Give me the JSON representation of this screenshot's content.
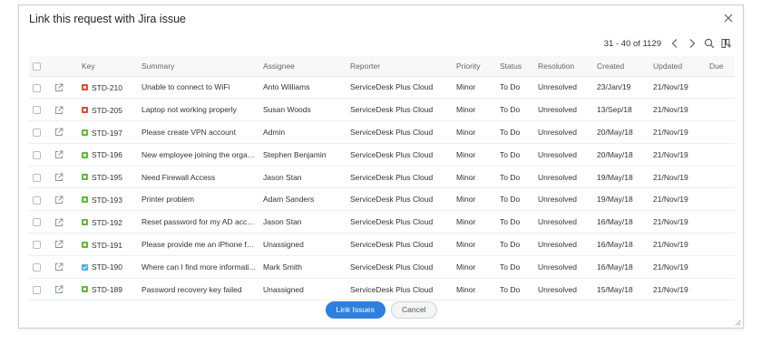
{
  "dialog": {
    "title": "Link this request with Jira issue",
    "pagination": "31 - 40 of 1129"
  },
  "table": {
    "headers": {
      "key": "Key",
      "summary": "Summary",
      "assignee": "Assignee",
      "reporter": "Reporter",
      "priority": "Priority",
      "status": "Status",
      "resolution": "Resolution",
      "created": "Created",
      "updated": "Updated",
      "due": "Due"
    },
    "rows": [
      {
        "type": "bug",
        "key": "STD-210",
        "summary": "Unable to connect to WiFi",
        "assignee": "Anto Williams",
        "reporter": "ServiceDesk Plus Cloud",
        "priority": "Minor",
        "status": "To Do",
        "resolution": "Unresolved",
        "created": "23/Jan/19",
        "updated": "21/Nov/19",
        "due": ""
      },
      {
        "type": "bug",
        "key": "STD-205",
        "summary": "Laptop not working properly",
        "assignee": "Susan Woods",
        "reporter": "ServiceDesk Plus Cloud",
        "priority": "Minor",
        "status": "To Do",
        "resolution": "Unresolved",
        "created": "13/Sep/18",
        "updated": "21/Nov/19",
        "due": ""
      },
      {
        "type": "story",
        "key": "STD-197",
        "summary": "Please create VPN account",
        "assignee": "Admin",
        "reporter": "ServiceDesk Plus Cloud",
        "priority": "Minor",
        "status": "To Do",
        "resolution": "Unresolved",
        "created": "20/May/18",
        "updated": "21/Nov/19",
        "due": ""
      },
      {
        "type": "story",
        "key": "STD-196",
        "summary": "New employee joining the organ...",
        "assignee": "Stephen Benjamin",
        "reporter": "ServiceDesk Plus Cloud",
        "priority": "Minor",
        "status": "To Do",
        "resolution": "Unresolved",
        "created": "20/May/18",
        "updated": "21/Nov/19",
        "due": ""
      },
      {
        "type": "story",
        "key": "STD-195",
        "summary": "Need Firewall Access",
        "assignee": "Jason Stan",
        "reporter": "ServiceDesk Plus Cloud",
        "priority": "Minor",
        "status": "To Do",
        "resolution": "Unresolved",
        "created": "19/May/18",
        "updated": "21/Nov/19",
        "due": ""
      },
      {
        "type": "story",
        "key": "STD-193",
        "summary": "Printer problem",
        "assignee": "Adam Sanders",
        "reporter": "ServiceDesk Plus Cloud",
        "priority": "Minor",
        "status": "To Do",
        "resolution": "Unresolved",
        "created": "19/May/18",
        "updated": "21/Nov/19",
        "due": ""
      },
      {
        "type": "story",
        "key": "STD-192",
        "summary": "Reset password for my AD acco...",
        "assignee": "Jason Stan",
        "reporter": "ServiceDesk Plus Cloud",
        "priority": "Minor",
        "status": "To Do",
        "resolution": "Unresolved",
        "created": "16/May/18",
        "updated": "21/Nov/19",
        "due": ""
      },
      {
        "type": "story",
        "key": "STD-191",
        "summary": "Please provide me an iPhone for...",
        "assignee": "Unassigned",
        "reporter": "ServiceDesk Plus Cloud",
        "priority": "Minor",
        "status": "To Do",
        "resolution": "Unresolved",
        "created": "16/May/18",
        "updated": "21/Nov/19",
        "due": ""
      },
      {
        "type": "task",
        "key": "STD-190",
        "summary": "Where can I find more informati...",
        "assignee": "Mark Smith",
        "reporter": "ServiceDesk Plus Cloud",
        "priority": "Minor",
        "status": "To Do",
        "resolution": "Unresolved",
        "created": "16/May/18",
        "updated": "21/Nov/19",
        "due": ""
      },
      {
        "type": "story",
        "key": "STD-189",
        "summary": "Password recovery key failed",
        "assignee": "Unassigned",
        "reporter": "ServiceDesk Plus Cloud",
        "priority": "Minor",
        "status": "To Do",
        "resolution": "Unresolved",
        "created": "15/May/18",
        "updated": "21/Nov/19",
        "due": ""
      }
    ]
  },
  "actions": {
    "link_label": "Link Issues",
    "cancel_label": "Cancel"
  },
  "icons": {
    "close": "close-icon",
    "prev": "chevron-left-icon",
    "next": "chevron-right-icon",
    "search": "search-icon",
    "columns": "column-chooser-icon",
    "open": "open-external-icon",
    "bug": "bug-type-icon",
    "story": "story-type-icon",
    "task": "task-type-icon"
  },
  "colors": {
    "primary": "#2e7fde",
    "bug": "#e5493a",
    "story": "#63ba3c",
    "task": "#4bade8"
  }
}
